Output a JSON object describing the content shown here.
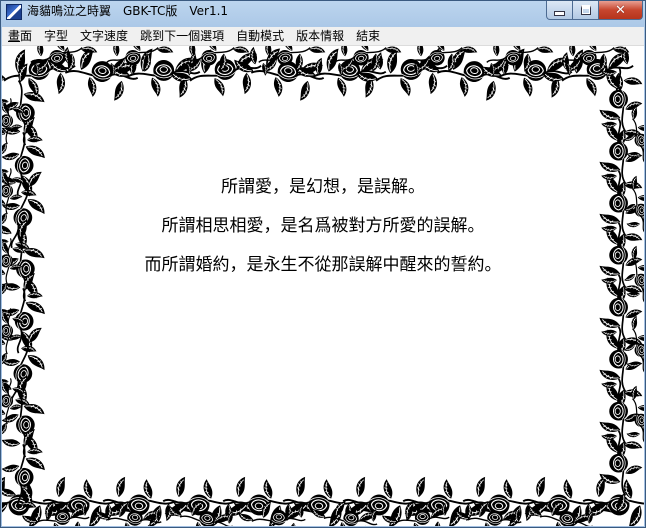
{
  "window": {
    "title": "海貓鳴泣之時翼　GBK-TC版　Ver1.1"
  },
  "titlebar_buttons": {
    "minimize_icon": "minimize-icon",
    "maximize_icon": "maximize-icon",
    "close_icon": "close-icon",
    "close_glyph": "✕"
  },
  "menu": [
    {
      "label": "畫面",
      "accent": "畫"
    },
    {
      "label": "字型"
    },
    {
      "label": "文字速度"
    },
    {
      "label": "跳到下一個選項"
    },
    {
      "label": "自動模式"
    },
    {
      "label": "版本情報"
    },
    {
      "label": "結束"
    }
  ],
  "poem": {
    "lines": [
      "所謂愛，是幻想，是誤解。",
      "所謂相思相愛，是名爲被對方所愛的誤解。",
      "而所謂婚約，是永生不從那誤解中醒來的誓約。"
    ]
  },
  "decoration": {
    "frame": "rose-leaf-border",
    "colors": {
      "ink": "#000000",
      "paper": "#ffffff"
    }
  }
}
